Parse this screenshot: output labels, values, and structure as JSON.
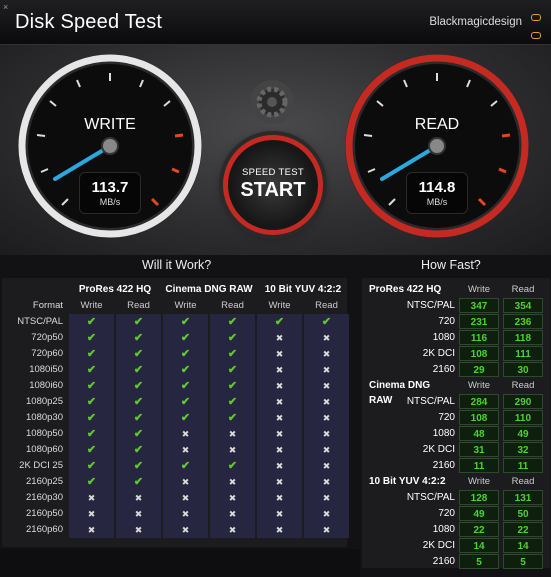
{
  "window": {
    "close_glyph": "×"
  },
  "header": {
    "title": "Disk Speed Test",
    "brand": "Blackmagicdesign"
  },
  "gauges": {
    "write": {
      "label": "WRITE",
      "value": "113.7",
      "unit": "MB/s"
    },
    "read": {
      "label": "READ",
      "value": "114.8",
      "unit": "MB/s"
    }
  },
  "start_button": {
    "line1": "SPEED TEST",
    "line2": "START"
  },
  "will_it_work": {
    "heading": "Will it Work?",
    "format_header": "Format",
    "groups": [
      "ProRes 422 HQ",
      "Cinema DNG RAW",
      "10 Bit YUV 4:2:2"
    ],
    "sub_headers": [
      "Write",
      "Read",
      "Write",
      "Read",
      "Write",
      "Read"
    ],
    "rows": [
      {
        "format": "NTSC/PAL",
        "marks": [
          "✔",
          "✔",
          "✔",
          "✔",
          "✔",
          "✔"
        ]
      },
      {
        "format": "720p50",
        "marks": [
          "✔",
          "✔",
          "✔",
          "✔",
          "✖",
          "✖"
        ]
      },
      {
        "format": "720p60",
        "marks": [
          "✔",
          "✔",
          "✔",
          "✔",
          "✖",
          "✖"
        ]
      },
      {
        "format": "1080i50",
        "marks": [
          "✔",
          "✔",
          "✔",
          "✔",
          "✖",
          "✖"
        ]
      },
      {
        "format": "1080i60",
        "marks": [
          "✔",
          "✔",
          "✔",
          "✔",
          "✖",
          "✖"
        ]
      },
      {
        "format": "1080p25",
        "marks": [
          "✔",
          "✔",
          "✔",
          "✔",
          "✖",
          "✖"
        ]
      },
      {
        "format": "1080p30",
        "marks": [
          "✔",
          "✔",
          "✔",
          "✔",
          "✖",
          "✖"
        ]
      },
      {
        "format": "1080p50",
        "marks": [
          "✔",
          "✔",
          "✖",
          "✖",
          "✖",
          "✖"
        ]
      },
      {
        "format": "1080p60",
        "marks": [
          "✔",
          "✔",
          "✖",
          "✖",
          "✖",
          "✖"
        ]
      },
      {
        "format": "2K DCI 25",
        "marks": [
          "✔",
          "✔",
          "✔",
          "✔",
          "✖",
          "✖"
        ]
      },
      {
        "format": "2160p25",
        "marks": [
          "✔",
          "✔",
          "✖",
          "✖",
          "✖",
          "✖"
        ]
      },
      {
        "format": "2160p30",
        "marks": [
          "✖",
          "✖",
          "✖",
          "✖",
          "✖",
          "✖"
        ]
      },
      {
        "format": "2160p50",
        "marks": [
          "✖",
          "✖",
          "✖",
          "✖",
          "✖",
          "✖"
        ]
      },
      {
        "format": "2160p60",
        "marks": [
          "✖",
          "✖",
          "✖",
          "✖",
          "✖",
          "✖"
        ]
      }
    ]
  },
  "how_fast": {
    "heading": "How Fast?",
    "write_header": "Write",
    "read_header": "Read",
    "sections": [
      {
        "name": "ProRes 422 HQ",
        "rows": [
          {
            "format": "NTSC/PAL",
            "write": "347",
            "read": "354"
          },
          {
            "format": "720",
            "write": "231",
            "read": "236"
          },
          {
            "format": "1080",
            "write": "116",
            "read": "118"
          },
          {
            "format": "2K DCI",
            "write": "108",
            "read": "111"
          },
          {
            "format": "2160",
            "write": "29",
            "read": "30"
          }
        ]
      },
      {
        "name": "Cinema DNG RAW",
        "rows": [
          {
            "format": "NTSC/PAL",
            "write": "284",
            "read": "290"
          },
          {
            "format": "720",
            "write": "108",
            "read": "110"
          },
          {
            "format": "1080",
            "write": "48",
            "read": "49"
          },
          {
            "format": "2K DCI",
            "write": "31",
            "read": "32"
          },
          {
            "format": "2160",
            "write": "11",
            "read": "11"
          }
        ]
      },
      {
        "name": "10 Bit YUV 4:2:2",
        "rows": [
          {
            "format": "NTSC/PAL",
            "write": "128",
            "read": "131"
          },
          {
            "format": "720",
            "write": "49",
            "read": "50"
          },
          {
            "format": "1080",
            "write": "22",
            "read": "22"
          },
          {
            "format": "2K DCI",
            "write": "14",
            "read": "14"
          },
          {
            "format": "2160",
            "write": "5",
            "read": "5"
          }
        ]
      }
    ]
  },
  "colors": {
    "accent_red": "#c42a22",
    "needle_blue": "#2aa8e0",
    "check_green": "#5fcb2b",
    "logo_orange": "#e89a32"
  }
}
